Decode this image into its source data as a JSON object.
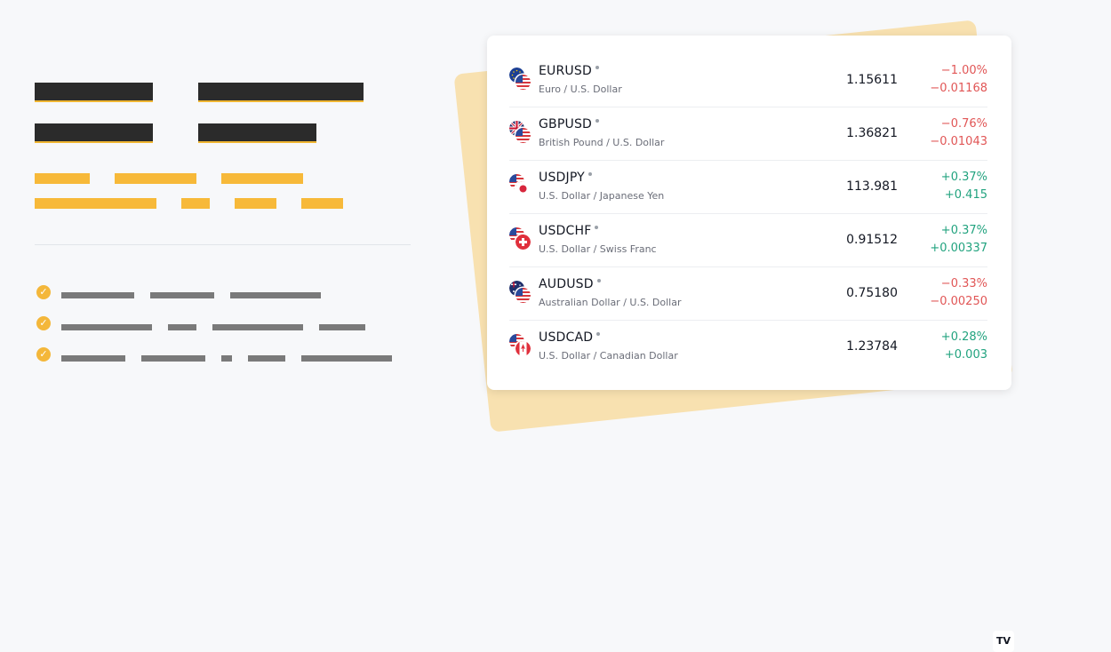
{
  "widget": {
    "rows": [
      {
        "symbol": "EURUSD",
        "description": "Euro / U.S. Dollar",
        "price": "1.15611",
        "change_pct": "−1.00%",
        "change_abs": "−0.01168",
        "direction": "down",
        "flags": [
          "eu",
          "us"
        ]
      },
      {
        "symbol": "GBPUSD",
        "description": "British Pound / U.S. Dollar",
        "price": "1.36821",
        "change_pct": "−0.76%",
        "change_abs": "−0.01043",
        "direction": "down",
        "flags": [
          "gb",
          "us"
        ]
      },
      {
        "symbol": "USDJPY",
        "description": "U.S. Dollar / Japanese Yen",
        "price": "113.981",
        "change_pct": "+0.37%",
        "change_abs": "+0.415",
        "direction": "up",
        "flags": [
          "us",
          "jp"
        ]
      },
      {
        "symbol": "USDCHF",
        "description": "U.S. Dollar / Swiss Franc",
        "price": "0.91512",
        "change_pct": "+0.37%",
        "change_abs": "+0.00337",
        "direction": "up",
        "flags": [
          "us",
          "ch"
        ]
      },
      {
        "symbol": "AUDUSD",
        "description": "Australian Dollar / U.S. Dollar",
        "price": "0.75180",
        "change_pct": "−0.33%",
        "change_abs": "−0.00250",
        "direction": "down",
        "flags": [
          "au",
          "us"
        ]
      },
      {
        "symbol": "USDCAD",
        "description": "U.S. Dollar / Canadian Dollar",
        "price": "1.23784",
        "change_pct": "+0.28%",
        "change_abs": "+0.003",
        "direction": "up",
        "flags": [
          "us",
          "ca"
        ]
      }
    ],
    "logo_text": "TV"
  },
  "colors": {
    "negative": "#e15656",
    "positive": "#22a37f",
    "accent": "#f7b939",
    "heading_block": "#2b2b2b"
  }
}
